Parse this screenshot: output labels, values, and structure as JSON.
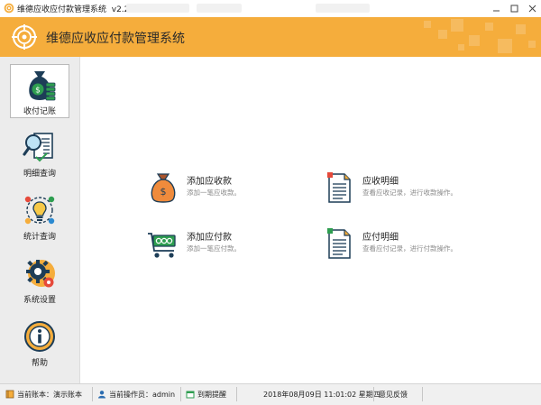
{
  "window": {
    "title": "维德应收应付款管理系统",
    "version": "v2.2.5"
  },
  "header": {
    "title": "维德应收应付款管理系统"
  },
  "sidebar": {
    "items": [
      {
        "label": "收付记账",
        "icon": "money-bag-icon",
        "active": true
      },
      {
        "label": "明细查询",
        "icon": "search-document-icon"
      },
      {
        "label": "统计查询",
        "icon": "statistics-bulb-icon"
      },
      {
        "label": "系统设置",
        "icon": "gear-icon"
      },
      {
        "label": "帮助",
        "icon": "info-icon"
      }
    ]
  },
  "main": {
    "actions": [
      {
        "title": "添加应收款",
        "desc": "添加一笔应收款。",
        "icon": "money-bag-icon"
      },
      {
        "title": "应收明细",
        "desc": "查看应收记录，进行收款操作。",
        "icon": "document-icon"
      },
      {
        "title": "添加应付款",
        "desc": "添加一笔应付款。",
        "icon": "cart-icon"
      },
      {
        "title": "应付明细",
        "desc": "查看应付记录，进行付款操作。",
        "icon": "document-icon"
      }
    ]
  },
  "status": {
    "account": "当前账本：演示账本",
    "operator": "当前操作员：admin",
    "reminder": "到期提醒",
    "datetime": "2018年08月09日  11:01:02 星期四",
    "feedback": "意见反馈"
  },
  "colors": {
    "header": "#f5ad3c",
    "sidebar": "#ececec",
    "accent_green": "#2e9e50",
    "accent_brown": "#a9542c"
  }
}
